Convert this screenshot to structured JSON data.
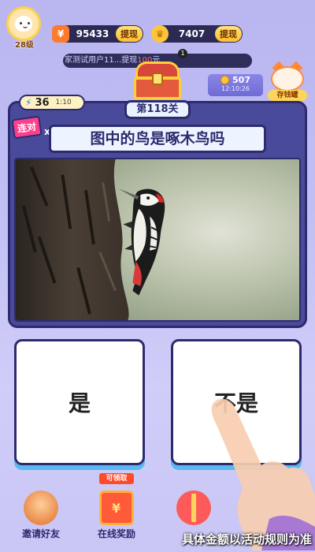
{
  "header": {
    "level_label": "28级",
    "cash": {
      "value": "95433",
      "withdraw_label": "提现",
      "icon": "cash-icon"
    },
    "gold": {
      "value": "7407",
      "withdraw_label": "提现",
      "icon": "crown-icon"
    }
  },
  "ticker": {
    "prefix": "家测试用户11...提现",
    "amount": "100",
    "suffix": "元",
    "badge": "1"
  },
  "piggy_bank": {
    "coins": "507",
    "timer": "12:10:26",
    "label": "存钱罐"
  },
  "energy": {
    "count": "36",
    "timer": "1:10"
  },
  "level_tab": "第118关",
  "combo": {
    "label": "连对",
    "multiplier": "x 5"
  },
  "question": {
    "text": "图中的鸟是啄木鸟吗",
    "image": "woodpecker-photo"
  },
  "answers": [
    {
      "label": "是"
    },
    {
      "label": "不是"
    }
  ],
  "bottom_bar": {
    "invite_label": "邀请好友",
    "online_reward_label": "在线奖励",
    "claim_badge": "可领取",
    "caption": "具体金额以活动规则为准"
  },
  "colors": {
    "background": "#c2bff5",
    "card": "#4a4a9a",
    "card_border": "#2d2b6e",
    "accent_pink": "#ff3f8c",
    "answer_shadow": "#5ab8f0"
  }
}
